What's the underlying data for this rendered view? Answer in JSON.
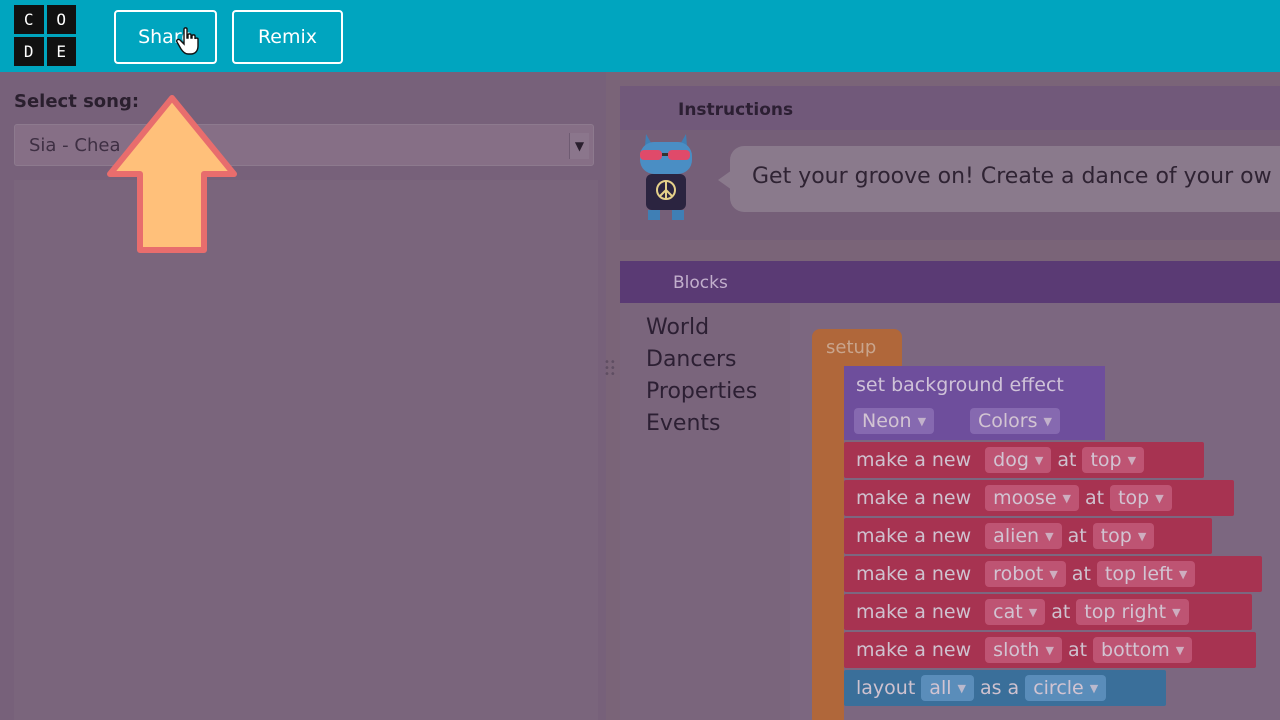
{
  "header": {
    "logo_letters": [
      "C",
      "O",
      "D",
      "E"
    ],
    "share_label": "Share",
    "remix_label": "Remix"
  },
  "left_panel": {
    "select_label": "Select song:",
    "selected_song": "Sia - Chea"
  },
  "instructions": {
    "title": "Instructions",
    "text": "Get your groove on! Create a dance of your ow"
  },
  "blocks": {
    "title": "Blocks",
    "categories": [
      "World",
      "Dancers",
      "Properties",
      "Events"
    ],
    "setup_label": "setup",
    "background": {
      "label": "set background effect",
      "effect": "Neon",
      "palette": "Colors"
    },
    "make_label": "make a new",
    "at_label": "at",
    "dancers": [
      {
        "type": "dog",
        "position": "top"
      },
      {
        "type": "moose",
        "position": "top"
      },
      {
        "type": "alien",
        "position": "top"
      },
      {
        "type": "robot",
        "position": "top left"
      },
      {
        "type": "cat",
        "position": "top right"
      },
      {
        "type": "sloth",
        "position": "bottom"
      }
    ],
    "layout": {
      "label": "layout",
      "target": "all",
      "as_label": "as a",
      "shape": "circle"
    }
  },
  "colors": {
    "header": "#00a5bf",
    "setup_block": "#b0673a",
    "world_block": "#6e4e9c",
    "dancer_block": "#a73351",
    "layout_block": "#3a6f9a",
    "arrow_fill": "#ffc07a",
    "arrow_stroke": "#e86d6d"
  }
}
